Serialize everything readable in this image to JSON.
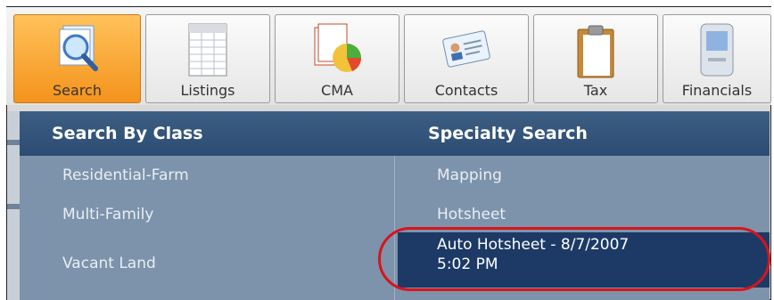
{
  "toolbar": {
    "tabs": [
      {
        "label": "Search",
        "icon": "search-magnifier-icon",
        "active": true
      },
      {
        "label": "Listings",
        "icon": "listings-sheet-icon",
        "active": false
      },
      {
        "label": "CMA",
        "icon": "cma-pie-chart-icon",
        "active": false
      },
      {
        "label": "Contacts",
        "icon": "contacts-card-icon",
        "active": false
      },
      {
        "label": "Tax",
        "icon": "tax-clipboard-icon",
        "active": false
      },
      {
        "label": "Financials",
        "icon": "financials-pda-icon",
        "active": false
      }
    ]
  },
  "menu": {
    "class_header": "Search By Class",
    "specialty_header": "Specialty Search",
    "class_items": [
      "Residential-Farm",
      "Multi-Family",
      "Vacant Land"
    ],
    "specialty_items": [
      "Mapping",
      "Hotsheet",
      "Auto Hotsheet - 8/7/2007",
      "5:02 PM"
    ]
  },
  "colors": {
    "active_tab": "#f4931c",
    "menu_header": "#2c4c73",
    "menu_bg": "#7c93ab",
    "selected_item": "#1d3a66",
    "annotation_ring": "#d8141b"
  }
}
